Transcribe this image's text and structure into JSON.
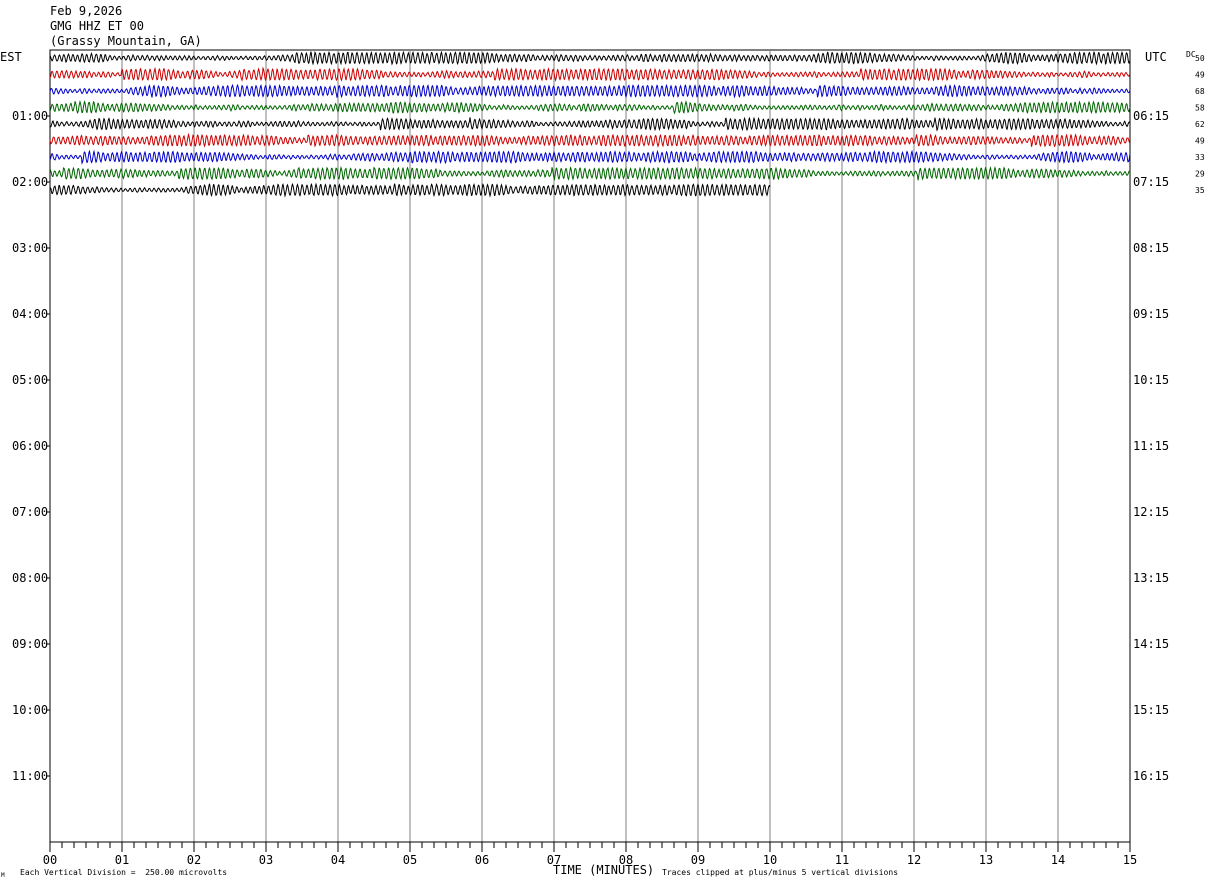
{
  "header": {
    "date": "Feb 9,2026",
    "station": "GMG HHZ ET 00",
    "location": "(Grassy Mountain, GA)"
  },
  "axis": {
    "left_tz": "EST",
    "right_tz": "UTC",
    "dc_label": "DC",
    "xlabel": "TIME (MINUTES)",
    "scale_note": "Each Vertical Division =  250.00 microvolts",
    "clip_note": "Traces clipped at plus/minus 5 vertical divisions",
    "corner_mark": "M"
  },
  "chart_data": {
    "type": "line",
    "title": "GMG HHZ ET 00 (Grassy Mountain, GA)",
    "xlabel": "TIME (MINUTES)",
    "x_ticks": [
      "00",
      "01",
      "02",
      "03",
      "04",
      "05",
      "06",
      "07",
      "08",
      "09",
      "10",
      "11",
      "12",
      "13",
      "14",
      "15"
    ],
    "xlim": [
      0,
      15
    ],
    "left_hours": [
      "01:00",
      "02:00",
      "03:00",
      "04:00",
      "05:00",
      "06:00",
      "07:00",
      "08:00",
      "09:00",
      "10:00",
      "11:00"
    ],
    "right_hours": [
      "06:15",
      "07:15",
      "08:15",
      "09:15",
      "10:15",
      "11:15",
      "12:15",
      "13:15",
      "14:15",
      "15:15",
      "16:15"
    ],
    "trace_colors": [
      "#000000",
      "#cc0000",
      "#0000cc",
      "#006600"
    ],
    "dc_values": [
      "50",
      "49",
      "68",
      "58",
      "62",
      "49",
      "33",
      "29",
      "35"
    ],
    "traces": [
      {
        "row": 0,
        "color": "#000000",
        "end_minute": 15
      },
      {
        "row": 1,
        "color": "#cc0000",
        "end_minute": 15
      },
      {
        "row": 2,
        "color": "#0000cc",
        "end_minute": 15
      },
      {
        "row": 3,
        "color": "#006600",
        "end_minute": 15
      },
      {
        "row": 4,
        "color": "#000000",
        "end_minute": 15
      },
      {
        "row": 5,
        "color": "#cc0000",
        "end_minute": 15
      },
      {
        "row": 6,
        "color": "#0000cc",
        "end_minute": 15
      },
      {
        "row": 7,
        "color": "#006600",
        "end_minute": 15
      },
      {
        "row": 8,
        "color": "#000000",
        "end_minute": 10
      }
    ]
  }
}
